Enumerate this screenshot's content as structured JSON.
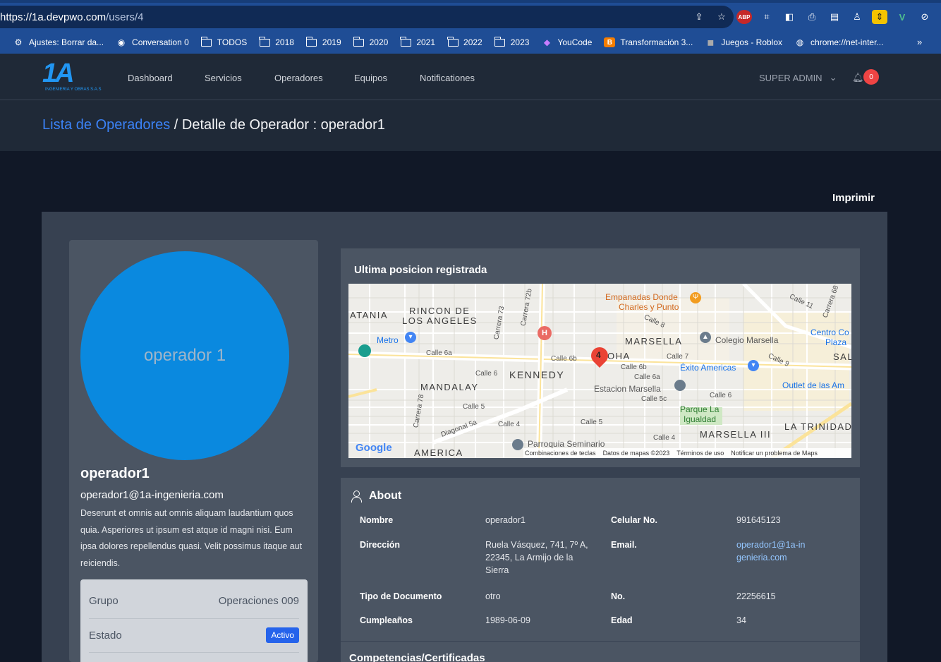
{
  "browser": {
    "url_host": "https://1a.devpwo.com",
    "url_path": "/users/4",
    "bookmarks": [
      {
        "label": "Ajustes: Borrar da...",
        "icon": "gear-icon"
      },
      {
        "label": "Conversation 0",
        "icon": "github-icon"
      },
      {
        "label": "TODOS",
        "icon": "folder-icon"
      },
      {
        "label": "2018",
        "icon": "folder-icon"
      },
      {
        "label": "2019",
        "icon": "folder-icon"
      },
      {
        "label": "2020",
        "icon": "folder-icon"
      },
      {
        "label": "2021",
        "icon": "folder-icon"
      },
      {
        "label": "2022",
        "icon": "folder-icon"
      },
      {
        "label": "2023",
        "icon": "folder-icon"
      },
      {
        "label": "YouCode",
        "icon": "youcode-icon"
      },
      {
        "label": "Transformación 3...",
        "icon": "blogger-icon"
      },
      {
        "label": "Juegos - Roblox",
        "icon": "roblox-icon"
      },
      {
        "label": "chrome://net-inter...",
        "icon": "globe-icon"
      }
    ],
    "more": "»",
    "extensions": {
      "abp": "ABP"
    }
  },
  "nav": {
    "logo_big": "1A",
    "logo_small": "INGENIERIA Y OBRAS S.A.S",
    "links": [
      "Dashboard",
      "Servicios",
      "Operadores",
      "Equipos",
      "Notificationes"
    ],
    "admin": "SUPER ADMIN",
    "notifications": "0"
  },
  "breadcrumb": {
    "link": "Lista de Operadores",
    "separator": " / ",
    "current": "Detalle de Operador : operador1"
  },
  "print_label": "Imprimir",
  "profile": {
    "avatar_text": "operador 1",
    "name": "operador1",
    "email": "operador1@1a-ingenieria.com",
    "description": "Deserunt et omnis aut omnis aliquam laudantium quos quia. Asperiores ut ipsum est atque id magni nisi. Eum ipsa dolores repellendus quasi. Velit possimus itaque aut reiciendis.",
    "group_label": "Grupo",
    "group_value": "Operaciones 009",
    "status_label": "Estado",
    "status_value": "Activo"
  },
  "map": {
    "title": "Ultima posicion registrada",
    "labels": {
      "catania": "ATANIA",
      "rincon1": "RINCON DE",
      "rincon2": "LOS ANGELES",
      "kennedy": "KENNEDY",
      "mandalay": "MANDALAY",
      "marsella": "MARSELLA",
      "boha": "OHA",
      "marsella3": "MARSELLA III",
      "trinidad": "LA TRINIDAD",
      "america": "AMERICA",
      "sal": "SAL",
      "metro": "Metro",
      "empanadas1": "Empanadas Donde",
      "empanadas2": "Charles y Punto",
      "colegio": "Colegio Marsella",
      "exito": "Éxito Americas",
      "centro1": "Centro Co",
      "centro2": "Plaza",
      "outlet": "Outlet de las Am",
      "estacion": "Estacion Marsella",
      "parque1": "Parque La",
      "parque2": "Igualdad",
      "parroquia": "Parroquia Seminario",
      "calle6a": "Calle 6a",
      "calle6": "Calle 6",
      "calle6_r": "Calle 6",
      "calle5": "Calle 5",
      "diagonal": "Diagonal 5a",
      "calle4": "Calle 4",
      "calle6b": "Calle 6b",
      "calle7": "Calle 7",
      "calle8": "Calle 8",
      "calle9": "Calle 9",
      "calle11": "Calle 11",
      "carrera73": "Carrera 73",
      "carrera72b": "Carrera 72b",
      "carrera78": "Carrera 78",
      "carrera68": "Carrera 68",
      "calle5b": "Calle 5",
      "calle4b": "Calle 4",
      "calle5c": "Calle 5c",
      "calle6a2": "Calle 6a",
      "calle6b2": "Calle 6b"
    },
    "pin_number": "4",
    "hospital": "H",
    "google": "Google",
    "footer": [
      "Combinaciones de teclas",
      "Datos de mapas ©2023",
      "Términos de uso",
      "Notificar un problema de Maps"
    ]
  },
  "about": {
    "title": "About",
    "rows": [
      {
        "l1": "Nombre",
        "v1": "operador1",
        "l2": "Celular No.",
        "v2": "991645123"
      },
      {
        "l1": "Dirección",
        "v1": "Ruela Vásquez, 741, 7º A, 22345, La Armijo de la Sierra",
        "l2": "Email.",
        "v2": "operador1@1a-ingenieria.com"
      },
      {
        "l1": "Tipo de Documento",
        "v1": "otro",
        "l2": "No.",
        "v2": "22256615"
      },
      {
        "l1": "Cumpleaños",
        "v1": "1989-06-09",
        "l2": "Edad",
        "v2": "34"
      }
    ]
  },
  "next_section": "Competencias/Certificadas"
}
